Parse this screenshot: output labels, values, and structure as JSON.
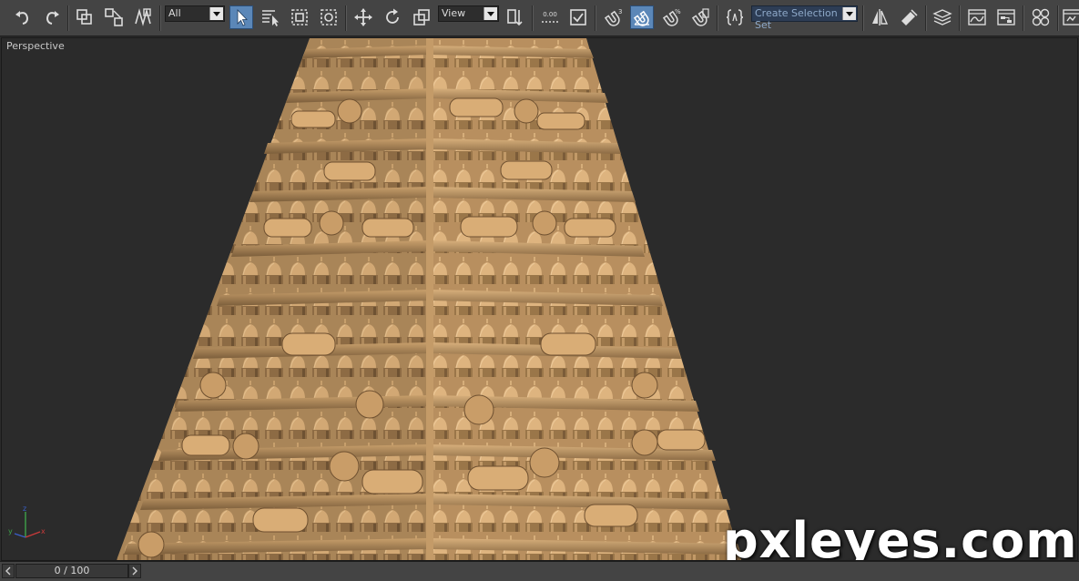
{
  "toolbar": {
    "selection_filter": "All",
    "ref_coord_system": "View",
    "spinner_snap_value": "0.00",
    "named_selection_placeholder": "Create Selection Set"
  },
  "viewport": {
    "label": "Perspective",
    "axis_labels": {
      "x": "x",
      "y": "y",
      "z": "z"
    },
    "model_color": "#b08b5e",
    "background_color": "#2b2b2b"
  },
  "watermark": "pxleyes.com",
  "timeline": {
    "frame_label": "0 / 100"
  },
  "colors": {
    "toolbar_bg": "#444444",
    "active_tool": "#5b87b8"
  }
}
